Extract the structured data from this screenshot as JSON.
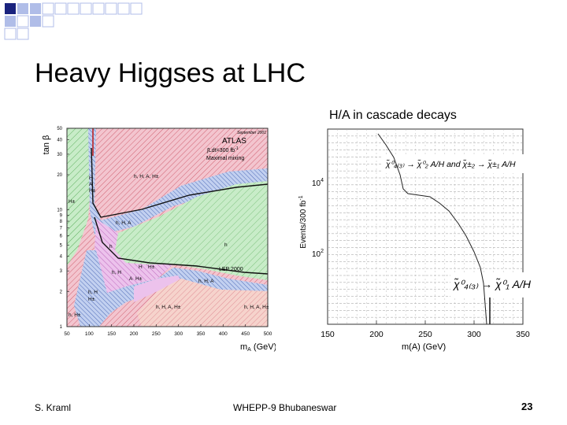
{
  "slide": {
    "title": "Heavy Higgses at LHC",
    "subtitle": "H/A in cascade decays",
    "footer_author": "S. Kraml",
    "footer_venue": "WHEPP-9 Bhubaneswar",
    "page_number": "23"
  },
  "left_plot": {
    "ylabel": "tan β",
    "xlabel": "m",
    "xlabel_sub": "A",
    "xlabel_unit": " (GeV)",
    "y_ticks": [
      "50",
      "40",
      "30",
      "20",
      "10",
      "9",
      "8",
      "7",
      "6",
      "5",
      "4",
      "3",
      "2",
      "1"
    ],
    "x_ticks": [
      "50",
      "100",
      "150",
      "200",
      "250",
      "300",
      "350",
      "400",
      "450",
      "500"
    ],
    "corner_note": "September 2001",
    "atlas": "ATLAS",
    "lumi": "∫Ldt=300 fb",
    "lumi_exp": "-1",
    "mixing": "Maximal mixing",
    "lep": "LEP 2000",
    "regions": [
      "H",
      "A",
      "H±",
      "H±",
      "h, H, A, H±",
      "h, H, A",
      "h",
      "h",
      "h, H",
      "H",
      "H±",
      "A",
      "H±",
      "h, H, A",
      "h, H",
      "H±",
      "h, H±",
      "h, H, A, H±",
      "h, H, A, H±"
    ]
  },
  "right_plot": {
    "ylabel": "Events/300 fb",
    "ylabel_exp": "-1",
    "xlabel": "m(A) (GeV)",
    "y_ticks": [
      {
        "base": "10",
        "exp": "4"
      },
      {
        "base": "10",
        "exp": "2"
      }
    ],
    "x_ticks": [
      "150",
      "200",
      "250",
      "300",
      "350"
    ],
    "decay_top": "χ̃⁰₄₍₃₎ → χ̃⁰₂ A/H and χ̃±₂ → χ̃±₁ A/H",
    "decay_bottom": "χ̃⁰₄₍₃₎ → χ̃⁰₁ A/H"
  },
  "colors": {
    "deco_dark": "#1a237e",
    "deco_light": "#b0bde8",
    "red_region": "#f3c5cf",
    "green_region": "#c8ecc8",
    "blue_region": "#c2d0f0",
    "magenta_region": "#ecc2ec",
    "pink_region": "#f6d3cc"
  }
}
